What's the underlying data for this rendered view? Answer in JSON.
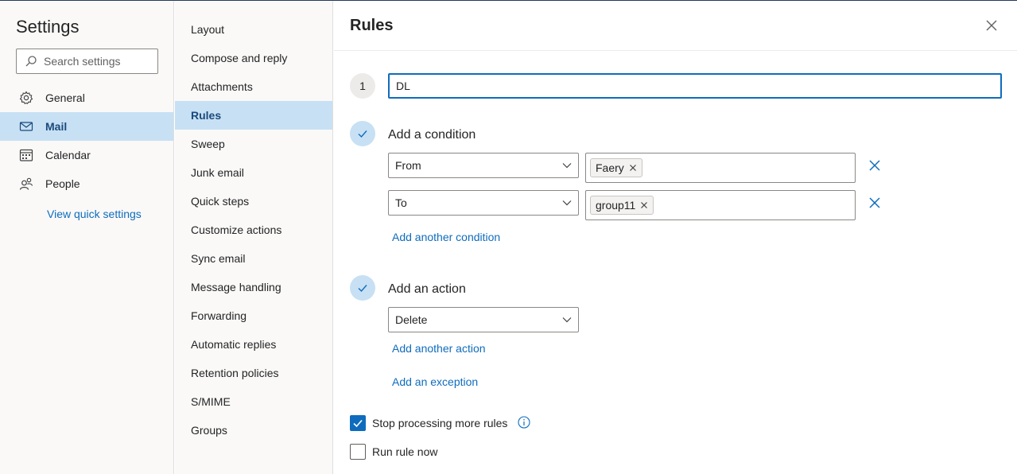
{
  "left_pane": {
    "title": "Settings",
    "search_placeholder": "Search settings",
    "nav": [
      {
        "label": "General",
        "icon": "gear-icon"
      },
      {
        "label": "Mail",
        "icon": "mail-icon",
        "active": true
      },
      {
        "label": "Calendar",
        "icon": "calendar-icon"
      },
      {
        "label": "People",
        "icon": "people-icon"
      }
    ],
    "view_quick_settings": "View quick settings"
  },
  "mid_pane": {
    "items": [
      "Layout",
      "Compose and reply",
      "Attachments",
      "Rules",
      "Sweep",
      "Junk email",
      "Quick steps",
      "Customize actions",
      "Sync email",
      "Message handling",
      "Forwarding",
      "Automatic replies",
      "Retention policies",
      "S/MIME",
      "Groups"
    ],
    "active_item": "Rules"
  },
  "rules": {
    "title": "Rules",
    "step_number": "1",
    "rule_name": "DL",
    "condition_heading": "Add a condition",
    "conditions": [
      {
        "field": "From",
        "value_chip": "Faery"
      },
      {
        "field": "To",
        "value_chip": "group11"
      }
    ],
    "add_condition_link": "Add another condition",
    "action_heading": "Add an action",
    "action": "Delete",
    "add_action_link": "Add another action",
    "add_exception_link": "Add an exception",
    "stop_processing_label": "Stop processing more rules",
    "stop_processing_checked": true,
    "run_now_label": "Run rule now",
    "run_now_checked": false
  },
  "colors": {
    "accent": "#0f6cbd",
    "selected_bg": "#c7e0f4",
    "pane_bg": "#faf9f8"
  }
}
